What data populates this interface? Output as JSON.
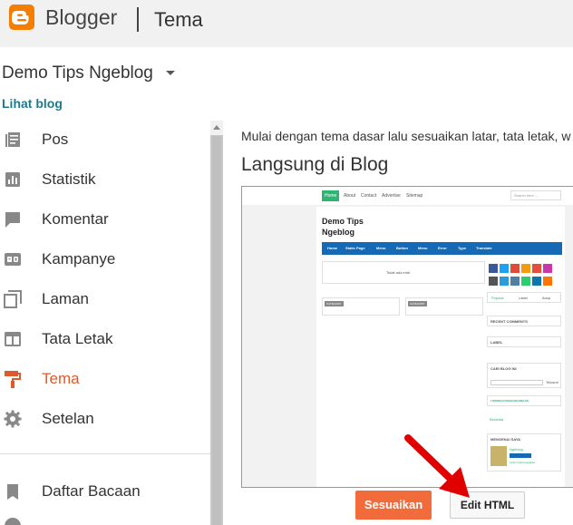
{
  "header": {
    "brand": "Blogger",
    "section": "Tema",
    "logo_icon": "blogger-logo-icon",
    "brand_color": "#f57d00"
  },
  "blog": {
    "name": "Demo Tips Ngeblog",
    "view_link": "Lihat blog"
  },
  "sidebar": {
    "items": [
      {
        "label": "Pos",
        "icon": "posts-icon"
      },
      {
        "label": "Statistik",
        "icon": "stats-icon"
      },
      {
        "label": "Komentar",
        "icon": "comment-icon"
      },
      {
        "label": "Kampanye",
        "icon": "ad-icon"
      },
      {
        "label": "Laman",
        "icon": "pages-icon"
      },
      {
        "label": "Tata Letak",
        "icon": "layout-icon"
      },
      {
        "label": "Tema",
        "icon": "paint-roller-icon",
        "active": true
      },
      {
        "label": "Setelan",
        "icon": "gear-icon"
      }
    ],
    "secondary": [
      {
        "label": "Daftar Bacaan",
        "icon": "bookmark-icon"
      }
    ],
    "active_color": "#e0592a"
  },
  "main": {
    "intro": "Mulai dengan tema dasar lalu sesuaikan latar, tata letak, w",
    "theme_name": "Langsung di Blog",
    "buttons": {
      "customize": "Sesuaikan",
      "edit_html": "Edit HTML"
    },
    "accent_color": "#f26b3a"
  },
  "preview": {
    "top_nav": [
      "Home",
      "About",
      "Contact",
      "Advertise",
      "Sitemap"
    ],
    "search_placeholder": "Search here ...",
    "blog_title_line1": "Demo Tips",
    "blog_title_line2": "Ngeblog",
    "menu": [
      "Home",
      "Static Page",
      "Menu",
      "Button",
      "Menu",
      "Error",
      "Type",
      "Translate"
    ],
    "empty_text": "Tidak ada entri",
    "category_label": "CATEGORY",
    "tabs": [
      "Popular",
      "Label",
      "Arsip"
    ],
    "widgets": [
      "RECENT COMMENTS",
      "LABEL",
      "CARI BLOG INI",
      "LOPERIAN PENGUNJUNGAN",
      "MENGENAI SAYA"
    ],
    "search_button": "Telusuri",
    "counter_text": "Beranda",
    "profile_name": "Ngeblog",
    "profile_link": "Lihat profil lengkapku"
  },
  "annotation": {
    "arrow_color": "#e00000"
  }
}
